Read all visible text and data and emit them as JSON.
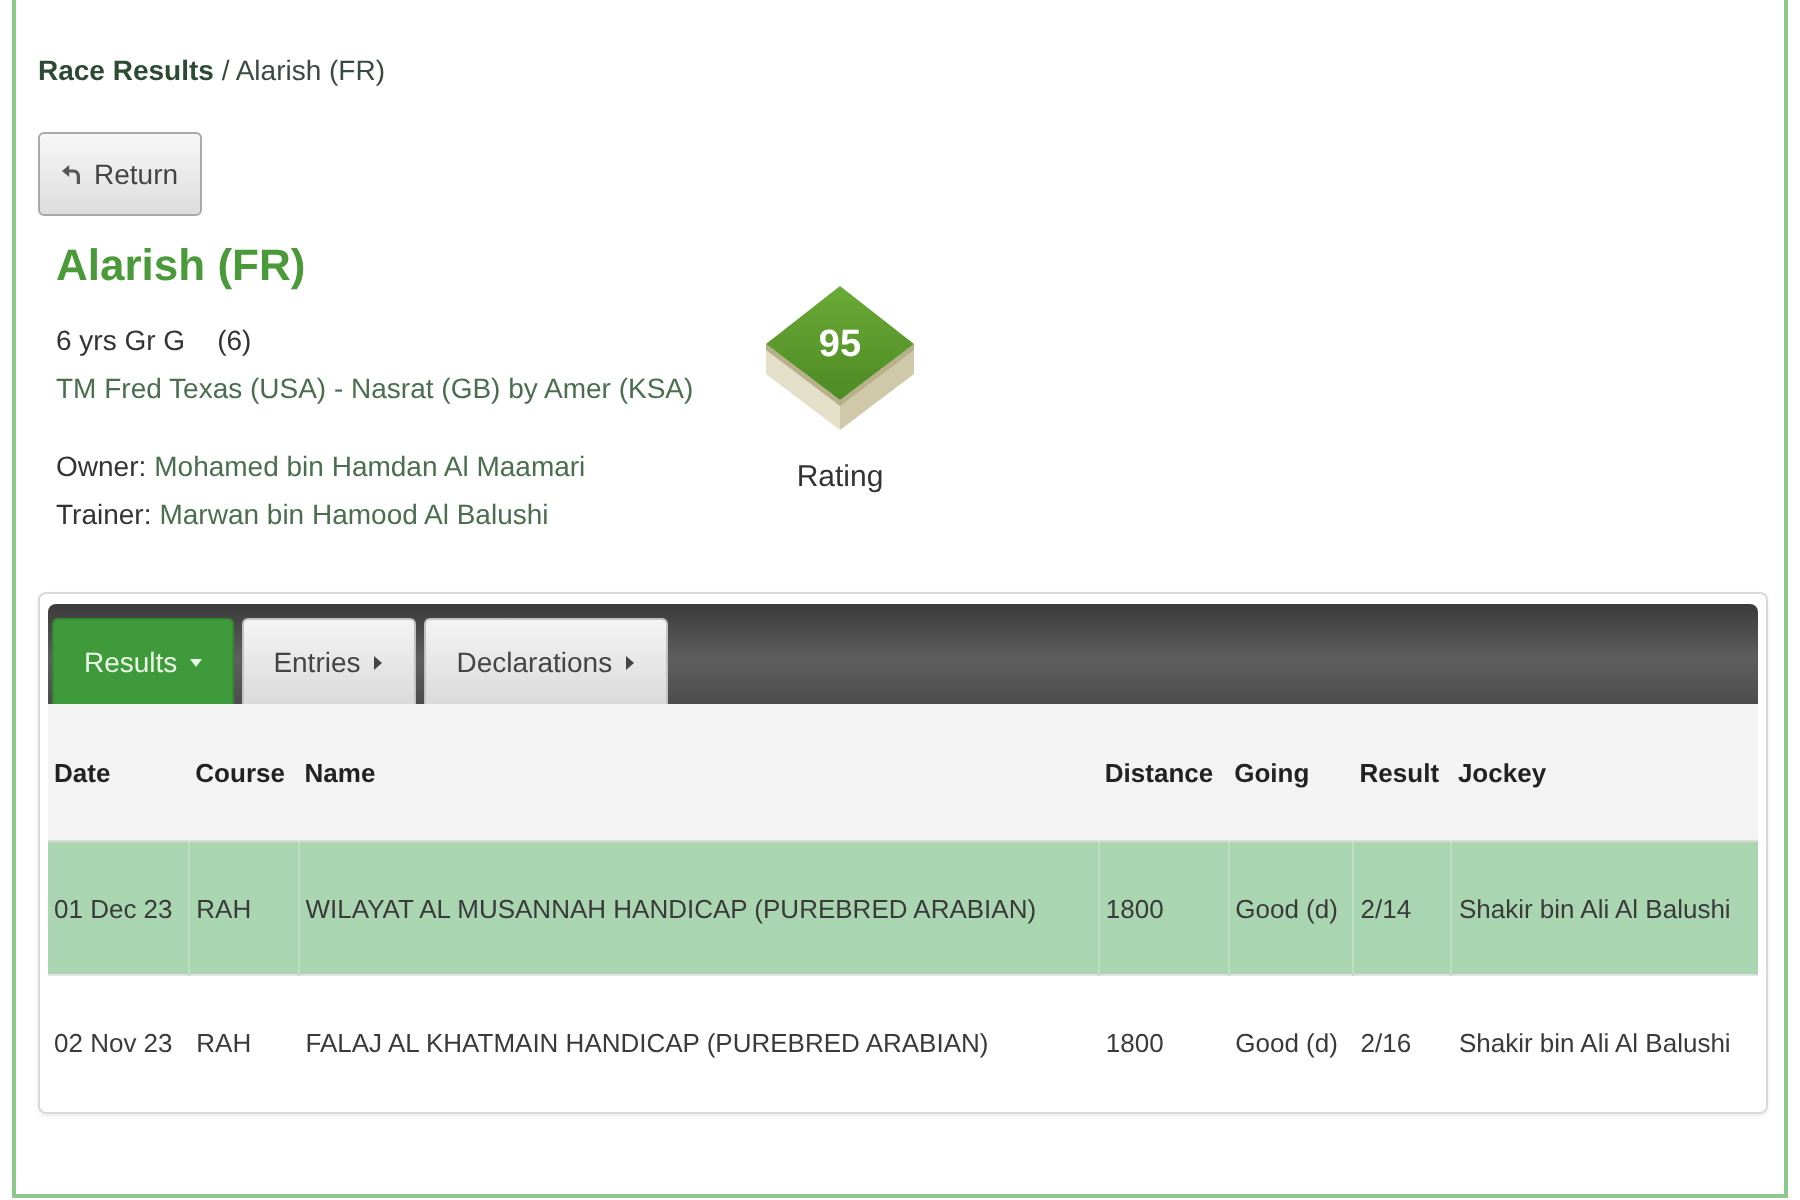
{
  "breadcrumb": {
    "link": "Race Results",
    "current": "/ Alarish (FR)"
  },
  "return_button": {
    "label": "Return"
  },
  "horse": {
    "name": "Alarish (FR)",
    "summary": "6 yrs Gr G",
    "summary_note": "(6)",
    "pedigree": "TM Fred Texas (USA) - Nasrat (GB) by Amer (KSA)",
    "owner": {
      "label": "Owner:",
      "value": "Mohamed bin Hamdan Al Maamari"
    },
    "trainer": {
      "label": "Trainer:",
      "value": "Marwan bin Hamood Al Balushi"
    }
  },
  "rating": {
    "value": "95",
    "label": "Rating"
  },
  "tabs": [
    {
      "label": "Results",
      "selected": true
    },
    {
      "label": "Entries",
      "selected": false
    },
    {
      "label": "Declarations",
      "selected": false
    }
  ],
  "table": {
    "columns": [
      "Date",
      "Course",
      "Name",
      "Distance",
      "Going",
      "Result",
      "Jockey"
    ],
    "rows": [
      {
        "selected": true,
        "cells": [
          "01 Dec 23",
          "RAH",
          "WILAYAT AL MUSANNAH HANDICAP (PUREBRED ARABIAN)",
          "1800",
          "Good (d)",
          "2/14",
          "Shakir bin Ali Al Balushi"
        ]
      },
      {
        "selected": false,
        "cells": [
          "02 Nov 23",
          "RAH",
          "FALAJ AL KHATMAIN HANDICAP (PUREBRED ARABIAN)",
          "1800",
          "Good (d)",
          "2/16",
          "Shakir bin Ali Al Balushi"
        ]
      }
    ]
  }
}
